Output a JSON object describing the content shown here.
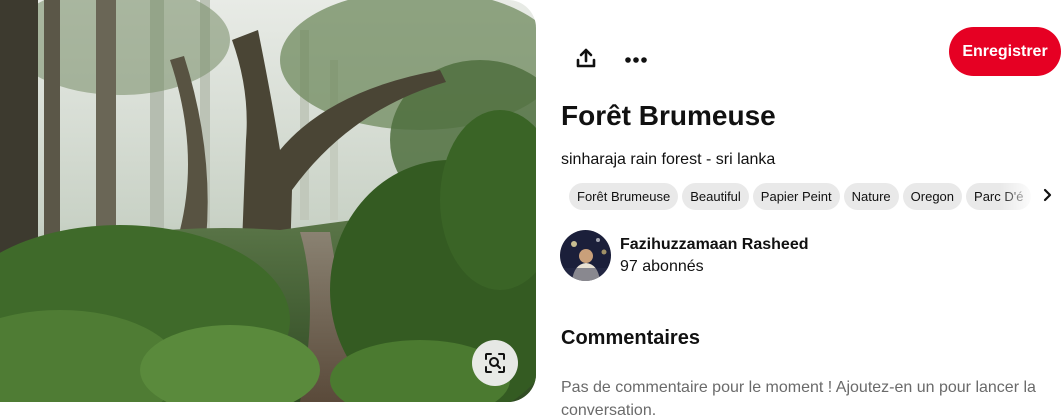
{
  "toolbar": {
    "share_icon": "share-upload-icon",
    "more_icon": "more-horizontal-icon",
    "save_label": "Enregistrer"
  },
  "pin": {
    "title": "Forêt Brumeuse",
    "description": "sinharaja rain forest - sri lanka",
    "image_subject": "misty forest path with ferns",
    "lens_icon": "visual-search-icon"
  },
  "tags": [
    "Forêt Brumeuse",
    "Beautiful",
    "Papier Peint",
    "Nature",
    "Oregon",
    "Parc D'é"
  ],
  "creator": {
    "name": "Fazihuzzamaan Rasheed",
    "followers": "97 abonnés"
  },
  "comments": {
    "heading": "Commentaires",
    "empty_text": "Pas de commentaire pour le moment ! Ajoutez-en un pour lancer la conversation."
  },
  "colors": {
    "accent": "#e60023",
    "chip_bg": "#e9e9e9",
    "muted_text": "#6a6a6a"
  }
}
